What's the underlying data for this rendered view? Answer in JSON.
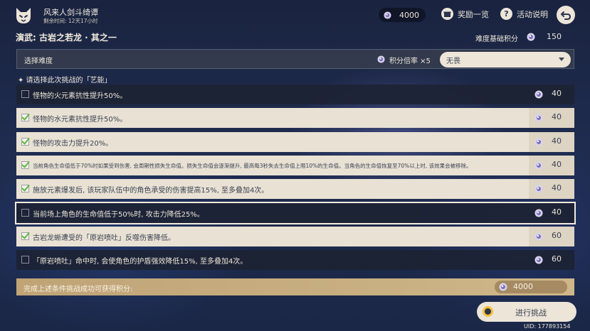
{
  "header": {
    "event_title": "风来人剑斗绮谭",
    "time_left": "剩余时间: 12天17小时",
    "currency_value": "4000",
    "rewards_label": "奖励一览",
    "info_label": "活动说明",
    "info_icon_glyph": "?"
  },
  "stage": {
    "title": "演武: 古岩之若龙 · 其之一",
    "base_score_label": "难度基础积分",
    "base_score_value": "150"
  },
  "difficulty": {
    "label": "选择难度",
    "multiplier": "积分倍率 ×5",
    "selected": "无畏"
  },
  "prompt": "✦ 请选择此次挑战的「艺能」",
  "challenges": [
    {
      "text": "怪物的火元素抗性提升50%。",
      "score": "40",
      "checked": false
    },
    {
      "text": "怪物的水元素抗性提升50%。",
      "score": "40",
      "checked": true
    },
    {
      "text": "怪物的攻击力提升20%。",
      "score": "40",
      "checked": true
    },
    {
      "text": "当前角色生命值低于70%时如果受到伤害, 会周期性损失生命值。损失生命值会逐渐提升, 最高每3秒失去生命值上限10%的生命值。当角色的生命值恢复至70%以上时, 该效果会被移除。",
      "score": "40",
      "checked": true,
      "small": true
    },
    {
      "text": "施放元素爆发后, 该玩家队伍中的角色承受的伤害提高15%, 至多叠加4次。",
      "score": "40",
      "checked": true
    },
    {
      "text": "当前场上角色的生命值低于50%时, 攻击力降低25%。",
      "score": "40",
      "checked": false,
      "selected": true
    },
    {
      "text": "古岩龙蜥遭受的「原岩喷吐」反噬伤害降低。",
      "score": "60",
      "checked": true
    },
    {
      "text": "「原岩喷吐」命中时, 会使角色的护盾强效降低15%, 至多叠加4次。",
      "score": "60",
      "checked": false
    }
  ],
  "total": {
    "label": "完成上述条件挑战成功可获得积分:",
    "value": "4000"
  },
  "start_button": "进行挑战",
  "uid": "UID: 177893154",
  "colors": {
    "row_on": "#e9e2d4",
    "row_off": "#1c2232",
    "checkmark": "#5fb846",
    "total_bar": "#d2b888",
    "button_ring": "#f0c23c"
  }
}
